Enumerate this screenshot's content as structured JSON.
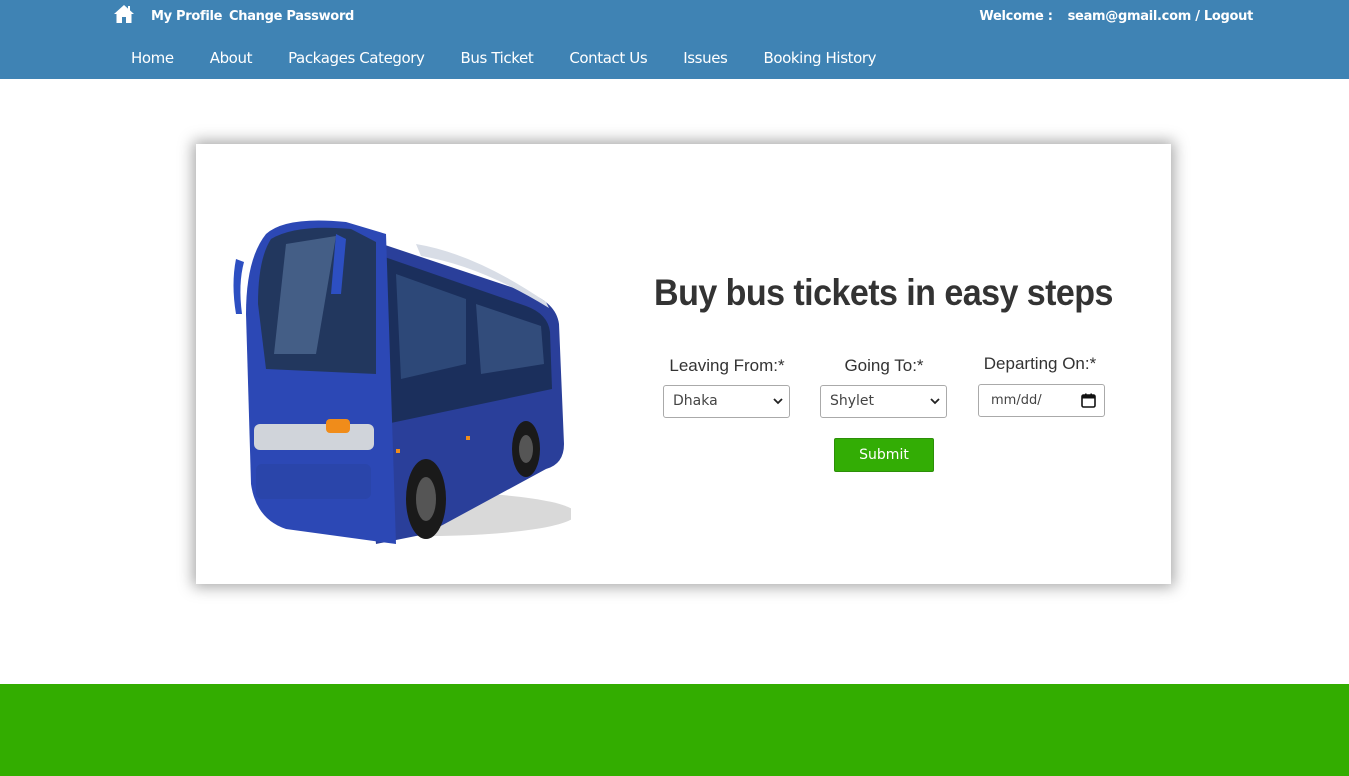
{
  "colors": {
    "header_bg": "#3f83b4",
    "footer_bg": "#33ad00",
    "accent_green": "#33ad05"
  },
  "topbar": {
    "home_icon": "home-icon",
    "my_profile": "My Profile",
    "change_password": "Change Password",
    "welcome_label": "Welcome :",
    "user_email": "seam@gmail.com",
    "separator": "/",
    "logout": "Logout"
  },
  "nav": {
    "items": [
      "Home",
      "About",
      "Packages Category",
      "Bus Ticket",
      "Contact Us",
      "Issues",
      "Booking History"
    ]
  },
  "booking": {
    "heading": "Buy bus tickets in easy steps",
    "leaving_from_label": "Leaving From:*",
    "leaving_from_value": "Dhaka",
    "going_to_label": "Going To:*",
    "going_to_value": "Shylet",
    "departing_on_label": "Departing On:*",
    "departing_on_placeholder": "mm/dd/",
    "submit_label": "Submit"
  }
}
